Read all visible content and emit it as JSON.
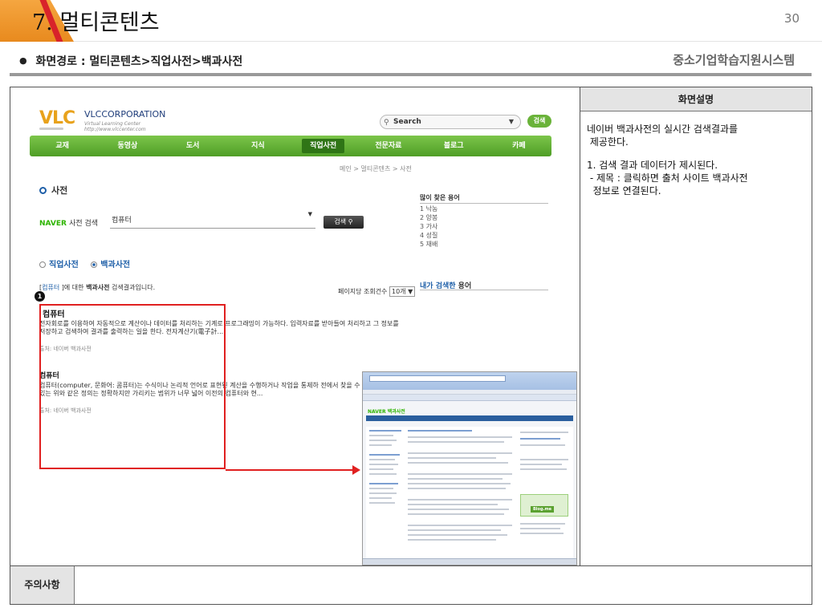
{
  "header": {
    "number": "7.",
    "title": "멀티콘텐츠",
    "page_number": "30"
  },
  "route": {
    "bullet": "●",
    "text": "화면경로 : 멀티콘텐츠>직업사전>백과사전"
  },
  "system_name": "중소기업학습지원시스템",
  "panel": {
    "header": "화면설명",
    "paragraph1_line1": "네이버 백과사전의 실시간 검색결과를",
    "paragraph1_line2": "제공한다.",
    "item1": "1. 검색 결과 데이터가 제시된다.",
    "item1_sub1": "- 제목 : 클릭하면 출처 사이트 백과사전",
    "item1_sub2": "정보로 연결된다."
  },
  "notes_label": "주의사항",
  "screenshot": {
    "logo": "VLC",
    "corp_name": "VLC",
    "corp_suffix": "CORPORATION",
    "corp_tag1": "Virtual Learning Center",
    "corp_tag2": "http://www.vlccenter.com",
    "top_search_label": "Search",
    "top_search_button": "검색",
    "nav": [
      "교재",
      "동영상",
      "도서",
      "지식",
      "직업사전",
      "전문자료",
      "블로그",
      "카페"
    ],
    "nav_active_index": 4,
    "breadcrumb": "메인 > 멀티콘텐츠 > 사전",
    "section_title": "사전",
    "naver_brand": "NAVER",
    "naver_label": "사전 검색",
    "query_value": "컴퓨터",
    "search_button": "검색",
    "radio_job": "직업사전",
    "radio_encyc": "백과사전",
    "result_prefix": "[",
    "result_keyword": "컴퓨터",
    "result_suffix": " ]에 대한 ",
    "result_bold": "백과사전",
    "result_tail": " 검색결과입니다.",
    "per_page_label": "페이지당 조회건수",
    "per_page_value": "10개",
    "callout_number": "1",
    "results": [
      {
        "title": "컴퓨터",
        "body": "전자회로를 이용하여 자동적으로 계산이나 데이터를 처리하는 기계로 프로그래밍이 가능하다. 입력자료를 받아들여 처리하고 그 정보를 저장하고 검색하여 결과를 출력하는 일을 한다. 전자계산기(電子計...",
        "source": "출처: 네이버 백과사전"
      },
      {
        "title": "컴퓨터",
        "body": "컴퓨터(computer, 문화어: 콤퓨터)는 수식이나 논리적 언어로 표현된 계산을 수행하거나 작업을 통제하 전에서 찾을 수 있는 위와 같은 정의는 정확하지만 가리키는 범위가 너무 넓어 이전의 컴퓨터와 현...",
        "source": "출처: 네이버 백과사전"
      }
    ],
    "popular_title": "많이 찾은 용어",
    "popular": [
      "1  낙농",
      "2  양봉",
      "3  가사",
      "4  성질",
      "5  재배"
    ],
    "my_search_blue": "내가 검색한",
    "my_search_rest": " 용어",
    "thumb_logo": "NAVER 백과사전",
    "thumb_blog": "Blog.me"
  }
}
